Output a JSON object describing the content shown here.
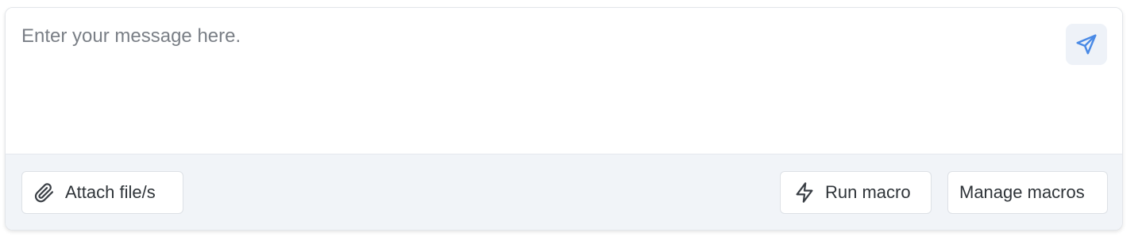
{
  "composer": {
    "message_placeholder": "Enter your message here.",
    "message_value": "",
    "send_icon": "send-icon"
  },
  "toolbar": {
    "attach_label": "Attach file/s",
    "attach_icon": "paperclip-icon",
    "run_macro_label": "Run macro",
    "run_macro_icon": "lightning-icon",
    "manage_macros_label": "Manage macros"
  },
  "colors": {
    "accent": "#4a8ae6",
    "toolbar_bg": "#f1f4f8",
    "send_button_bg": "#eef2f8"
  }
}
